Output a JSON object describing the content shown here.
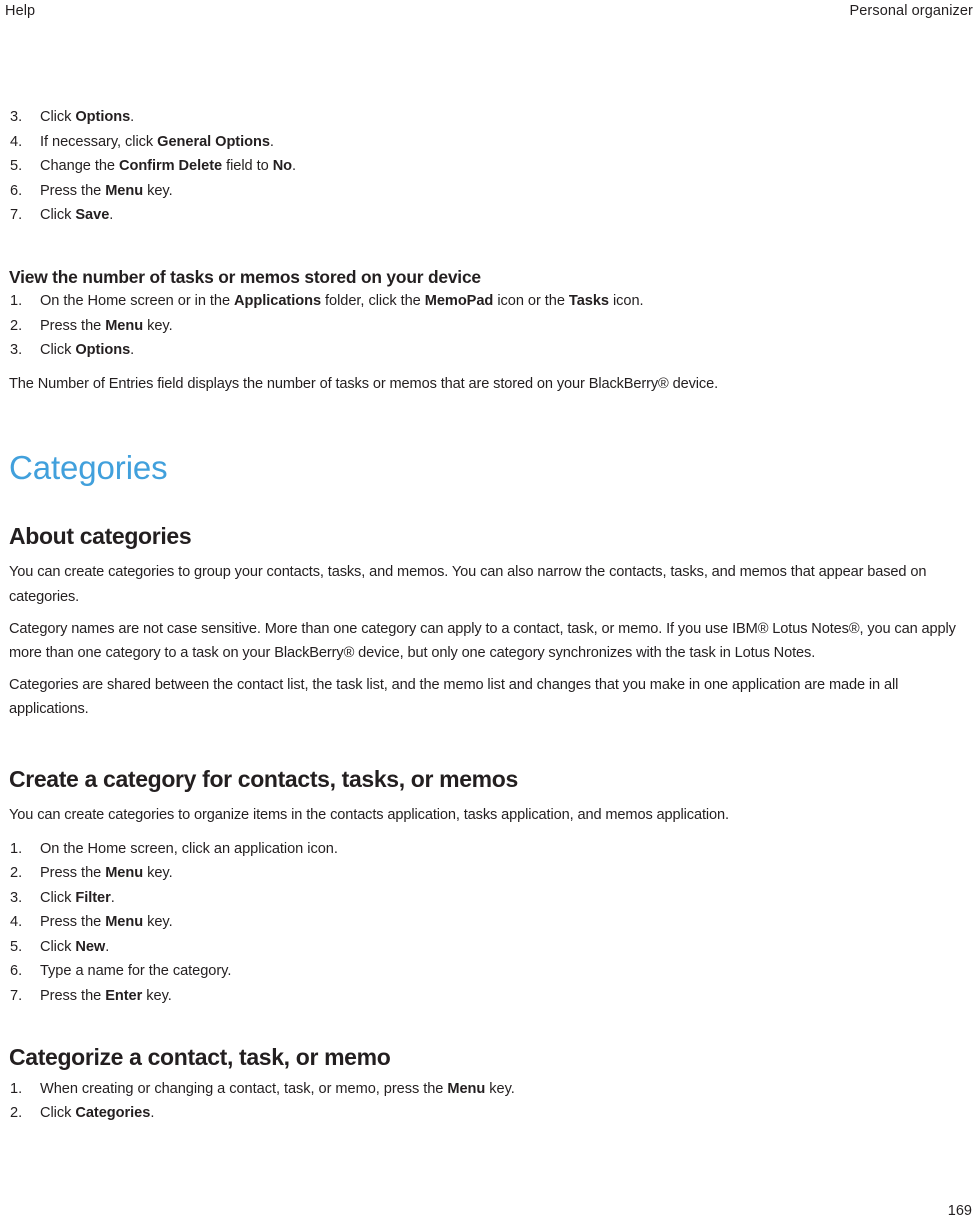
{
  "header": {
    "left": "Help",
    "right": "Personal organizer"
  },
  "footer": {
    "page_number": "169"
  },
  "colors": {
    "chapter_heading": "#41a0dc",
    "body_text": "#231f20",
    "page_background": "#ffffff"
  },
  "content": {
    "continued_steps": [
      {
        "num": "3.",
        "html": "Click <b>Options</b>."
      },
      {
        "num": "4.",
        "html": "If necessary, click <b>General Options</b>."
      },
      {
        "num": "5.",
        "html": "Change the <b>Confirm Delete</b> field to <b>No</b>."
      },
      {
        "num": "6.",
        "html": "Press the <b>Menu</b> key."
      },
      {
        "num": "7.",
        "html": "Click <b>Save</b>."
      }
    ],
    "view_number_section": {
      "heading": "View the number of tasks or memos stored on your device",
      "steps": [
        {
          "num": "1.",
          "html": "On the Home screen or in the <b>Applications</b> folder, click the <b>MemoPad</b> icon or the <b>Tasks</b> icon."
        },
        {
          "num": "2.",
          "html": "Press the <b>Menu</b> key."
        },
        {
          "num": "3.",
          "html": "Click <b>Options</b>."
        }
      ],
      "note": "The Number of Entries field displays the number of tasks or memos that are stored on your BlackBerry® device."
    },
    "categories_chapter": {
      "title": "Categories",
      "about": {
        "heading": "About categories",
        "paragraphs": [
          "You can create categories to group your contacts, tasks, and memos. You can also narrow the contacts, tasks, and memos that appear based on categories.",
          "Category names are not case sensitive. More than one category can apply to a contact, task, or memo. If you use IBM® Lotus Notes®, you can apply more than one category to a task on your BlackBerry® device, but only one category synchronizes with the task in Lotus Notes.",
          "Categories are shared between the contact list, the task list, and the memo list and changes that you make in one application are made in all applications."
        ]
      },
      "create_category": {
        "heading": "Create a category for contacts, tasks, or memos",
        "intro": "You can create categories to organize items in the contacts application, tasks application, and memos application.",
        "steps": [
          {
            "num": "1.",
            "html": "On the Home screen, click an application icon."
          },
          {
            "num": "2.",
            "html": "Press the <b>Menu</b> key."
          },
          {
            "num": "3.",
            "html": "Click <b>Filter</b>."
          },
          {
            "num": "4.",
            "html": "Press the <b>Menu</b> key."
          },
          {
            "num": "5.",
            "html": "Click <b>New</b>."
          },
          {
            "num": "6.",
            "html": "Type a name for the category."
          },
          {
            "num": "7.",
            "html": "Press the <b>Enter</b> key."
          }
        ]
      },
      "categorize": {
        "heading": "Categorize a contact, task, or memo",
        "steps": [
          {
            "num": "1.",
            "html": "When creating or changing a contact, task, or memo, press the <b>Menu</b> key."
          },
          {
            "num": "2.",
            "html": "Click <b>Categories</b>."
          }
        ]
      }
    }
  }
}
